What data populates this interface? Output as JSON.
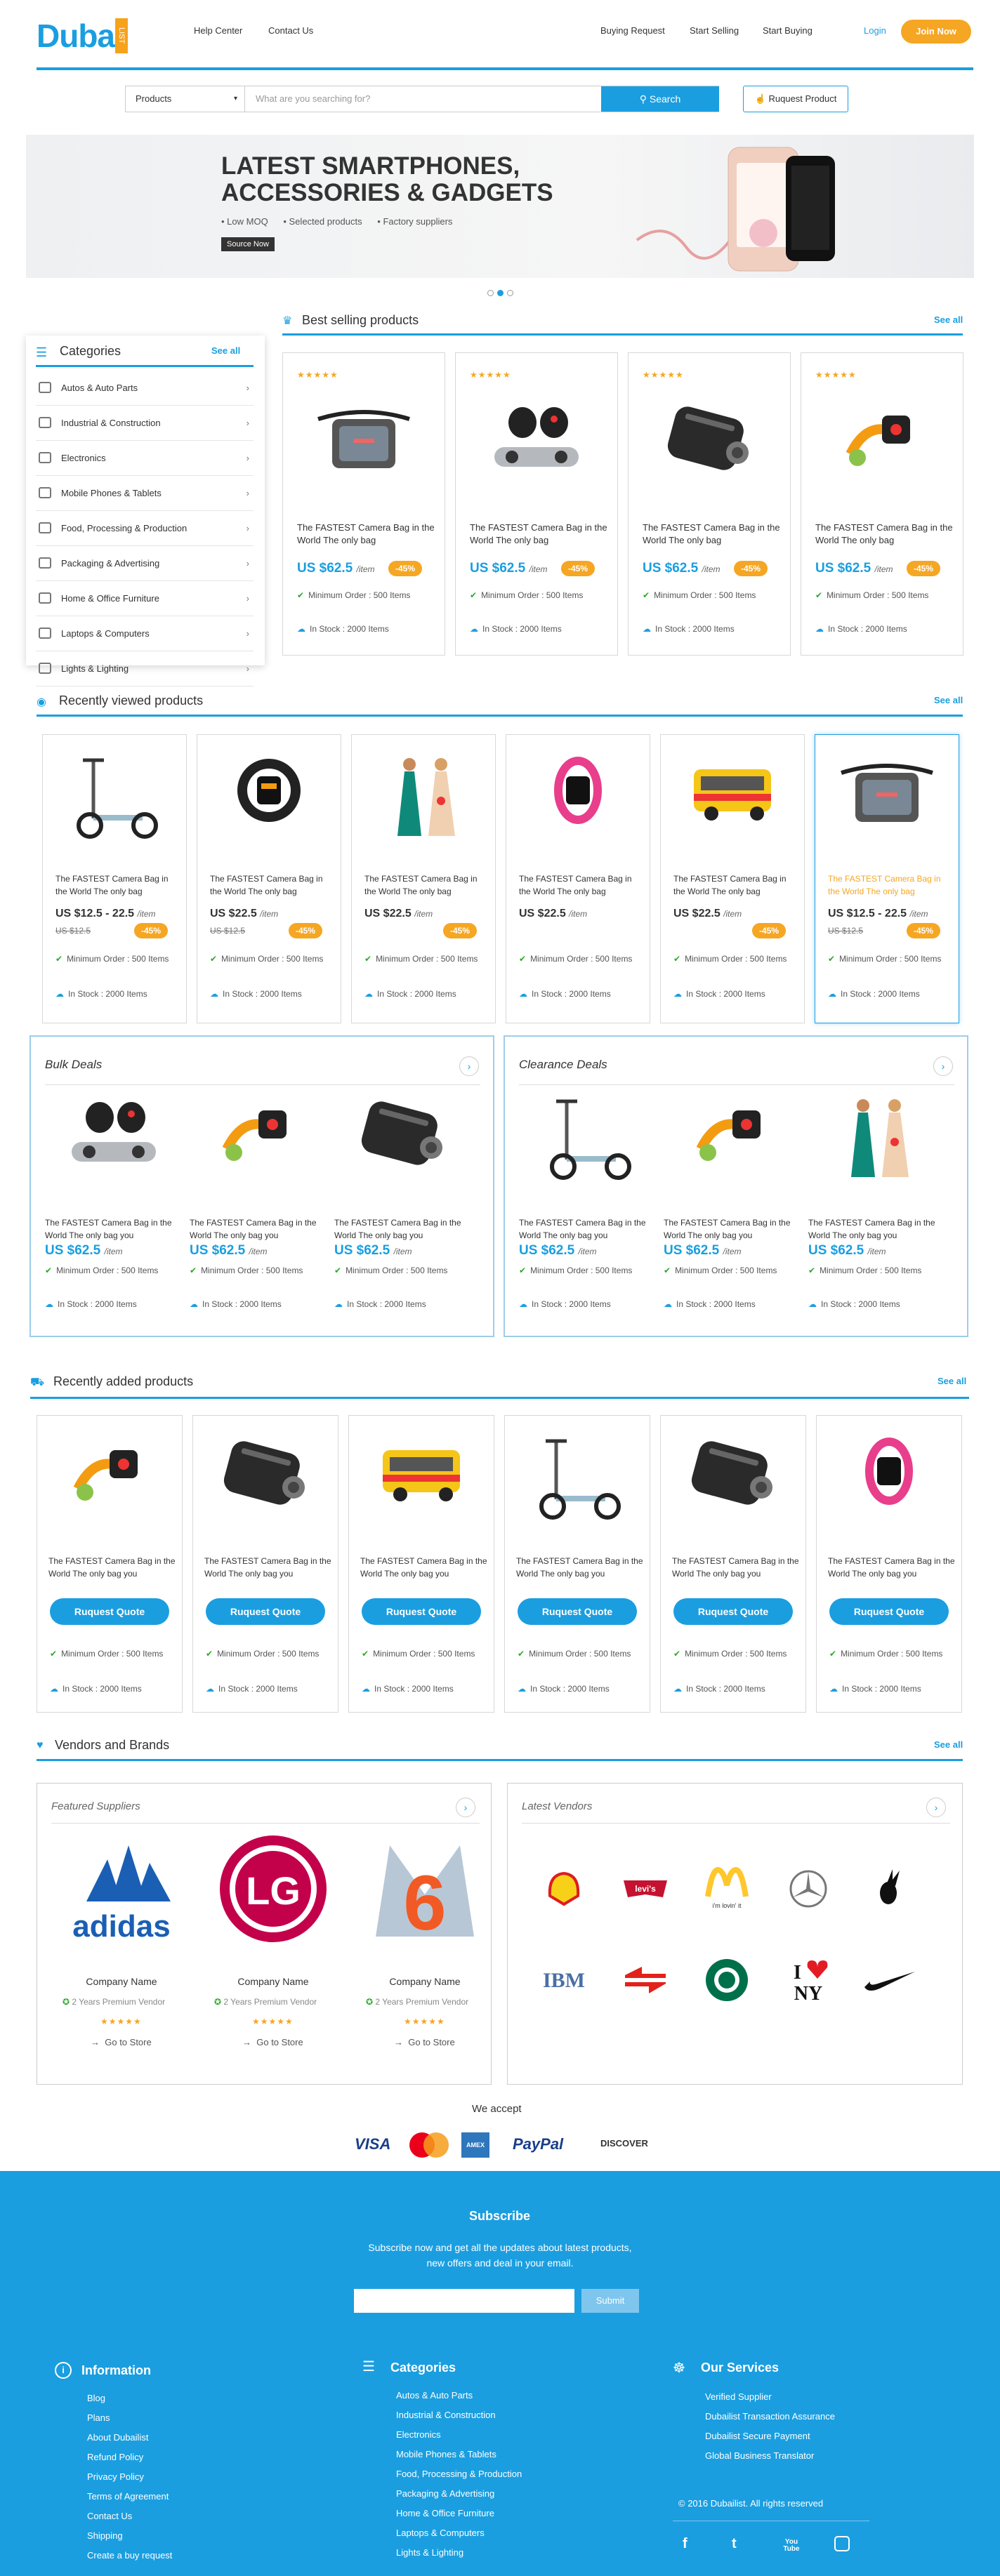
{
  "header": {
    "logo_text": "Duba",
    "logo_side": "LIST",
    "nav_left": [
      "Help Center",
      "Contact Us"
    ],
    "nav_right": [
      "Buying Request",
      "Start Selling",
      "Start Buying"
    ],
    "login": "Login",
    "join": "Join Now"
  },
  "search": {
    "category": "Products",
    "placeholder": "What are you searching for?",
    "button": "Search",
    "request": "Ruquest Product"
  },
  "banner": {
    "title": "LATEST SMARTPHONES, ACCESSORIES & GADGETS",
    "bullets": [
      "Low MOQ",
      "Selected products",
      "Factory suppliers"
    ],
    "cta": "Source Now",
    "slides": 3,
    "active_slide": 1
  },
  "categories": {
    "title": "Categories",
    "see_all": "See all",
    "items": [
      "Autos & Auto Parts",
      "Industrial & Construction",
      "Electronics",
      "Mobile Phones & Tablets",
      "Food, Processing & Production",
      "Packaging & Advertising",
      "Home & Office Furniture",
      "Laptops & Computers",
      "Lights & Lighting"
    ]
  },
  "best_selling": {
    "title": "Best selling products",
    "see_all": "See all",
    "products": [
      {
        "title": "The FASTEST Camera Bag in the World The only bag",
        "price": "US $62.5",
        "unit": "/item",
        "discount": "-45%",
        "min_order": "Minimum Order : 500 Items",
        "stock": "In Stock : 2000 Items",
        "img": "bag"
      },
      {
        "title": "The FASTEST Camera Bag in the World The only bag",
        "price": "US $62.5",
        "unit": "/item",
        "discount": "-45%",
        "min_order": "Minimum Order : 500 Items",
        "stock": "In Stock : 2000 Items",
        "img": "earbuds"
      },
      {
        "title": "The FASTEST Camera Bag in the World The only bag",
        "price": "US $62.5",
        "unit": "/item",
        "discount": "-45%",
        "min_order": "Minimum Order : 500 Items",
        "stock": "In Stock : 2000 Items",
        "img": "charger"
      },
      {
        "title": "The FASTEST Camera Bag in the World The only bag",
        "price": "US $62.5",
        "unit": "/item",
        "discount": "-45%",
        "min_order": "Minimum Order : 500 Items",
        "stock": "In Stock : 2000 Items",
        "img": "peeler"
      }
    ]
  },
  "recently_viewed": {
    "title": "Recently viewed products",
    "see_all": "See all",
    "products": [
      {
        "title": "The FASTEST Camera Bag in the World The only bag",
        "price": "US $12.5 - 22.5",
        "unit": "/item",
        "old": "US $12.5",
        "discount": "-45%",
        "min_order": "Minimum Order : 500 Items",
        "stock": "In Stock : 2000 Items",
        "img": "scooter"
      },
      {
        "title": "The FASTEST Camera Bag in the World The only bag",
        "price": "US $22.5",
        "unit": "/item",
        "old": "US $12.5",
        "discount": "-45%",
        "min_order": "Minimum Order : 500 Items",
        "stock": "In Stock : 2000 Items",
        "img": "watch"
      },
      {
        "title": "The FASTEST Camera Bag in the World The only bag",
        "price": "US $22.5",
        "unit": "/item",
        "old": "",
        "discount": "-45%",
        "min_order": "Minimum Order : 500 Items",
        "stock": "In Stock : 2000 Items",
        "img": "dress"
      },
      {
        "title": "The FASTEST Camera Bag in the World The only bag",
        "price": "US $22.5",
        "unit": "/item",
        "old": "",
        "discount": "",
        "min_order": "Minimum Order : 500 Items",
        "stock": "In Stock : 2000 Items",
        "img": "band"
      },
      {
        "title": "The FASTEST Camera Bag in the World The only bag",
        "price": "US $22.5",
        "unit": "/item",
        "old": "",
        "discount": "-45%",
        "min_order": "Minimum Order : 500 Items",
        "stock": "In Stock : 2000 Items",
        "img": "bus"
      },
      {
        "title": "The FASTEST Camera Bag in the World The only bag",
        "price": "US $12.5 - 22.5",
        "unit": "/item",
        "old": "US $12.5",
        "discount": "-45%",
        "min_order": "Minimum Order : 500 Items",
        "stock": "In Stock : 2000 Items",
        "img": "bag"
      }
    ]
  },
  "bulk_deals": {
    "title": "Bulk Deals",
    "products": [
      {
        "title": "The FASTEST Camera Bag in the World The only bag you",
        "price": "US $62.5",
        "unit": "/item",
        "min_order": "Minimum Order : 500 Items",
        "stock": "In Stock : 2000 Items",
        "img": "earbuds"
      },
      {
        "title": "The FASTEST Camera Bag in the World The only bag you",
        "price": "US $62.5",
        "unit": "/item",
        "min_order": "Minimum Order : 500 Items",
        "stock": "In Stock : 2000 Items",
        "img": "peeler"
      },
      {
        "title": "The FASTEST Camera Bag in the World The only bag you",
        "price": "US $62.5",
        "unit": "/item",
        "min_order": "Minimum Order : 500 Items",
        "stock": "In Stock : 2000 Items",
        "img": "charger"
      }
    ]
  },
  "clearance_deals": {
    "title": "Clearance Deals",
    "products": [
      {
        "title": "The FASTEST Camera Bag in the World The only bag you",
        "price": "US $62.5",
        "unit": "/item",
        "min_order": "Minimum Order : 500 Items",
        "stock": "In Stock : 2000 Items",
        "img": "scooter"
      },
      {
        "title": "The FASTEST Camera Bag in the World The only bag you",
        "price": "US $62.5",
        "unit": "/item",
        "min_order": "Minimum Order : 500 Items",
        "stock": "In Stock : 2000 Items",
        "img": "peeler"
      },
      {
        "title": "The FASTEST Camera Bag in the World The only bag you",
        "price": "US $62.5",
        "unit": "/item",
        "min_order": "Minimum Order : 500 Items",
        "stock": "In Stock : 2000 Items",
        "img": "dress"
      }
    ]
  },
  "recently_added": {
    "title": "Recently added products",
    "see_all": "See all",
    "button": "Ruquest Quote",
    "products": [
      {
        "title": "The FASTEST Camera Bag in the World The only bag you",
        "min_order": "Minimum Order : 500 Items",
        "stock": "In Stock : 2000 Items",
        "img": "peeler"
      },
      {
        "title": "The FASTEST Camera Bag in the World The only bag you",
        "min_order": "Minimum Order : 500 Items",
        "stock": "In Stock : 2000 Items",
        "img": "charger"
      },
      {
        "title": "The FASTEST Camera Bag in the World The only bag you",
        "min_order": "Minimum Order : 500 Items",
        "stock": "In Stock : 2000 Items",
        "img": "bus"
      },
      {
        "title": "The FASTEST Camera Bag in the World The only bag you",
        "min_order": "Minimum Order : 500 Items",
        "stock": "In Stock : 2000 Items",
        "img": "scooter"
      },
      {
        "title": "The FASTEST Camera Bag in the World The only bag you",
        "min_order": "Minimum Order : 500 Items",
        "stock": "In Stock : 2000 Items",
        "img": "charger"
      },
      {
        "title": "The FASTEST Camera Bag in the World The only bag you",
        "min_order": "Minimum Order : 500 Items",
        "stock": "In Stock : 2000 Items",
        "img": "band"
      }
    ]
  },
  "vendors": {
    "title": "Vendors and Brands",
    "see_all": "See all",
    "featured_title": "Featured Suppliers",
    "latest_title": "Latest Vendors",
    "featured": [
      {
        "logo": "adidas",
        "name": "Company Name",
        "badge": "2 Years Premium Vendor",
        "link": "Go to Store"
      },
      {
        "logo": "LG",
        "name": "Company Name",
        "badge": "2 Years Premium Vendor",
        "link": "Go to Store"
      },
      {
        "logo": "6",
        "name": "Company Name",
        "badge": "2 Years Premium Vendor",
        "link": "Go to Store"
      }
    ],
    "latest": [
      "shell",
      "levi's",
      "McDonald's",
      "mercedes",
      "playboy",
      "IBM",
      "rail",
      "starbucks",
      "I love NY",
      "nike"
    ],
    "latest_text": {
      "levis": "levi's",
      "mcd_tag": "i'm lovin' it",
      "ibm": "IBM",
      "ny_i": "I",
      "ny_ny": "NY"
    }
  },
  "payments": {
    "title": "We accept",
    "methods": [
      "VISA",
      "MasterCard",
      "AMEX",
      "PayPal",
      "DISCOVER"
    ]
  },
  "footer": {
    "subscribe_title": "Subscribe",
    "subscribe_text_1": "Subscribe now and get all the updates about latest products,",
    "subscribe_text_2": "new offers and deal in your email.",
    "subscribe_button": "Submit",
    "info_title": "Information",
    "info_links": [
      "Blog",
      "Plans",
      "About Dubailist",
      "Refund Policy",
      "Privacy Policy",
      "Terms of Agreement",
      "Contact Us",
      "Shipping",
      "Create a buy request"
    ],
    "cat_title": "Categories",
    "cat_links": [
      "Autos & Auto Parts",
      "Industrial & Construction",
      "Electronics",
      "Mobile Phones & Tablets",
      "Food, Processing & Production",
      "Packaging & Advertising",
      "Home & Office Furniture",
      "Laptops & Computers",
      "Lights & Lighting"
    ],
    "services_title": "Our Services",
    "services_links": [
      "Verified Supplier",
      "Dubailist Transaction Assurance",
      "Dubailist Secure Payment",
      "Global Business Translator"
    ],
    "copyright": "© 2016 Dubailist. All rights reserved",
    "social": [
      "f",
      "t",
      "You Tube",
      "ig"
    ]
  },
  "colors": {
    "accent": "#1a9ee0",
    "orange": "#f5a623",
    "green": "#2aa92a"
  }
}
